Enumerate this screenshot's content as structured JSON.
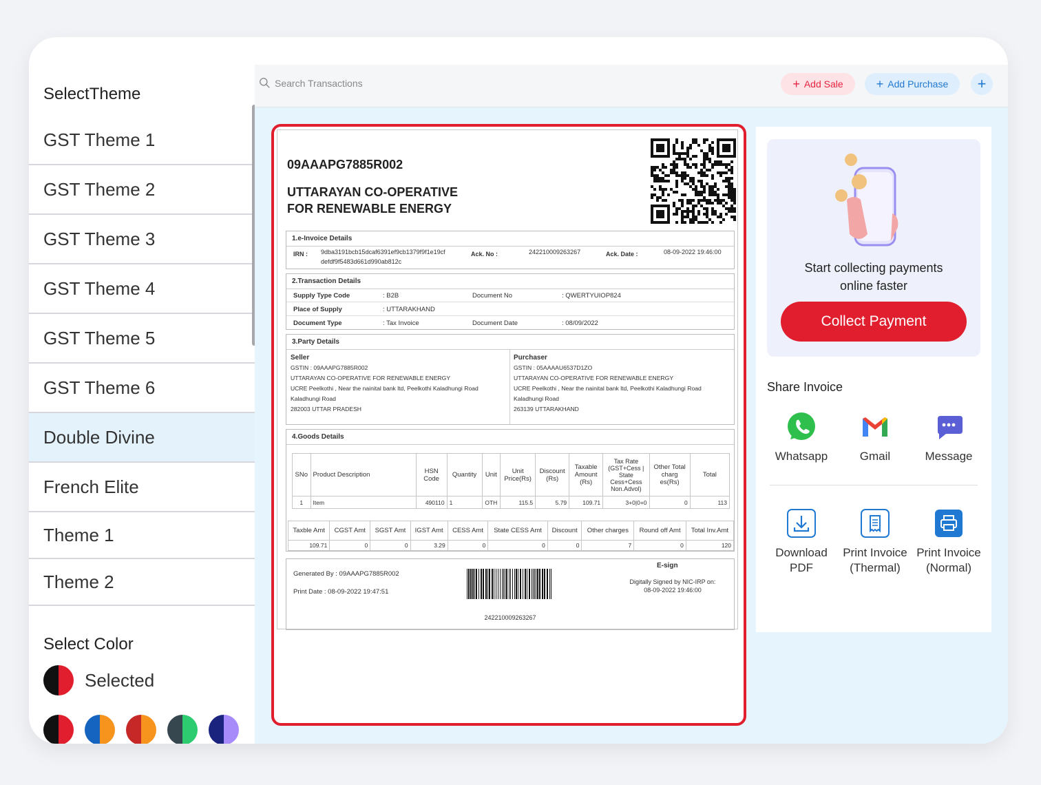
{
  "sidebar": {
    "title": "SelectTheme",
    "themes": [
      "GST Theme 1",
      "GST Theme 2",
      "GST Theme 3",
      "GST Theme 4",
      "GST Theme 5",
      "GST Theme 6",
      "Double Divine",
      "French Elite",
      "Theme 1",
      "Theme 2"
    ],
    "active_theme": "Double Divine",
    "color_title": "Select Color",
    "selected_label": "Selected",
    "selected_colors": [
      "#111111",
      "#e01e2d"
    ],
    "swatches": [
      [
        "#111111",
        "#e01e2d"
      ],
      [
        "#1565c0",
        "#f7941d"
      ],
      [
        "#c62828",
        "#f7941d"
      ],
      [
        "#37474f",
        "#2ecc71"
      ],
      [
        "#1a237e",
        "#a78bfa"
      ]
    ]
  },
  "topbar": {
    "search_placeholder": "Search Transactions",
    "add_sale": "Add Sale",
    "add_purchase": "Add Purchase",
    "plus": "+"
  },
  "invoice": {
    "gstin": "09AAAPG7885R002",
    "company_line1": "UTTARAYAN CO-OPERATIVE",
    "company_line2": "FOR RENEWABLE ENERGY",
    "einvoice": {
      "title": "1.e-Invoice Details",
      "irn_label": "IRN :",
      "irn_line1": "9dba3191bcb15dcaf6391ef9cb1379f9f1e19cf",
      "irn_line2": "defdf9f5483d661d990ab812c",
      "ack_no_label": "Ack. No :",
      "ack_no": "242210009263267",
      "ack_date_label": "Ack. Date :",
      "ack_date": "08-09-2022 19:46:00"
    },
    "transaction": {
      "title": "2.Transaction Details",
      "supply_type_label": "Supply Type Code",
      "supply_type": ": B2B",
      "doc_no_label": "Document No",
      "doc_no": ": QWERTYUIOP824",
      "place_label": "Place of Supply",
      "place": ": UTTARAKHAND",
      "doc_type_label": "Document Type",
      "doc_type": ": Tax Invoice",
      "doc_date_label": "Document Date",
      "doc_date": ": 08/09/2022"
    },
    "party": {
      "title": "3.Party Details",
      "seller_label": "Seller",
      "seller_gstin": "GSTIN : 09AAAPG7885R002",
      "seller_name": "UTTARAYAN CO-OPERATIVE FOR RENEWABLE ENERGY",
      "seller_addr1": "UCRE Peelkothi , Near the nainital bank ltd, Peelkothi Kaladhungi Road",
      "seller_addr2": "Kaladhungi Road",
      "seller_addr3": "282003 UTTAR PRADESH",
      "purchaser_label": "Purchaser",
      "purchaser_gstin": "GSTIN : 05AAAAU6537D1ZO",
      "purchaser_name": "UTTARAYAN CO-OPERATIVE FOR RENEWABLE ENERGY",
      "purchaser_addr1": "UCRE Peelkothi , Near the nainital bank ltd, Peelkothi Kaladhungi Road",
      "purchaser_addr2": "Kaladhungi Road",
      "purchaser_addr3": "263139 UTTARAKHAND"
    },
    "goods": {
      "title": "4.Goods Details",
      "headers": [
        "SNo",
        "Product Description",
        "HSN Code",
        "Quantity",
        "Unit",
        "Unit Price(Rs)",
        "Discount (Rs)",
        "Taxable Amount (Rs)",
        "Tax Rate (GST+Cess | State Cess+Cess Non.Advol)",
        "Other Total charg es(Rs)",
        "Total"
      ],
      "row": [
        "1",
        "Item",
        "490110",
        "1",
        "OTH",
        "115.5",
        "5.79",
        "109.71",
        "3+0|0+0",
        "0",
        "113"
      ],
      "sum_headers": [
        "Taxble Amt",
        "CGST Amt",
        "SGST Amt",
        "IGST Amt",
        "CESS Amt",
        "State CESS Amt",
        "Discount",
        "Other charges",
        "Round off Amt",
        "Total Inv.Amt"
      ],
      "sum_row": [
        "109.71",
        "0",
        "0",
        "3.29",
        "0",
        "0",
        "0",
        "7",
        "0",
        "120"
      ]
    },
    "footer": {
      "generated_by": "Generated By : 09AAAPG7885R002",
      "print_date": "Print Date : 08-09-2022 19:47:51",
      "esign": "E-sign",
      "signed_line1": "Digitally Signed by NIC-IRP on:",
      "signed_line2": "08-09-2022 19:46:00",
      "barcode_number": "242210009263267"
    }
  },
  "right_panel": {
    "promo_line1": "Start collecting payments",
    "promo_line2": "online faster",
    "collect_button": "Collect Payment",
    "share_title": "Share Invoice",
    "share": [
      {
        "label": "Whatsapp",
        "icon": "whatsapp-icon"
      },
      {
        "label": "Gmail",
        "icon": "gmail-icon"
      },
      {
        "label": "Message",
        "icon": "message-icon"
      }
    ],
    "actions": [
      {
        "line1": "Download",
        "line2": "PDF",
        "icon": "download-icon"
      },
      {
        "line1": "Print Invoice",
        "line2": "(Thermal)",
        "icon": "receipt-icon"
      },
      {
        "line1": "Print Invoice",
        "line2": "(Normal)",
        "icon": "printer-icon"
      }
    ],
    "colors": {
      "brand_red": "#e01e2d",
      "brand_blue": "#1f78d1"
    }
  }
}
